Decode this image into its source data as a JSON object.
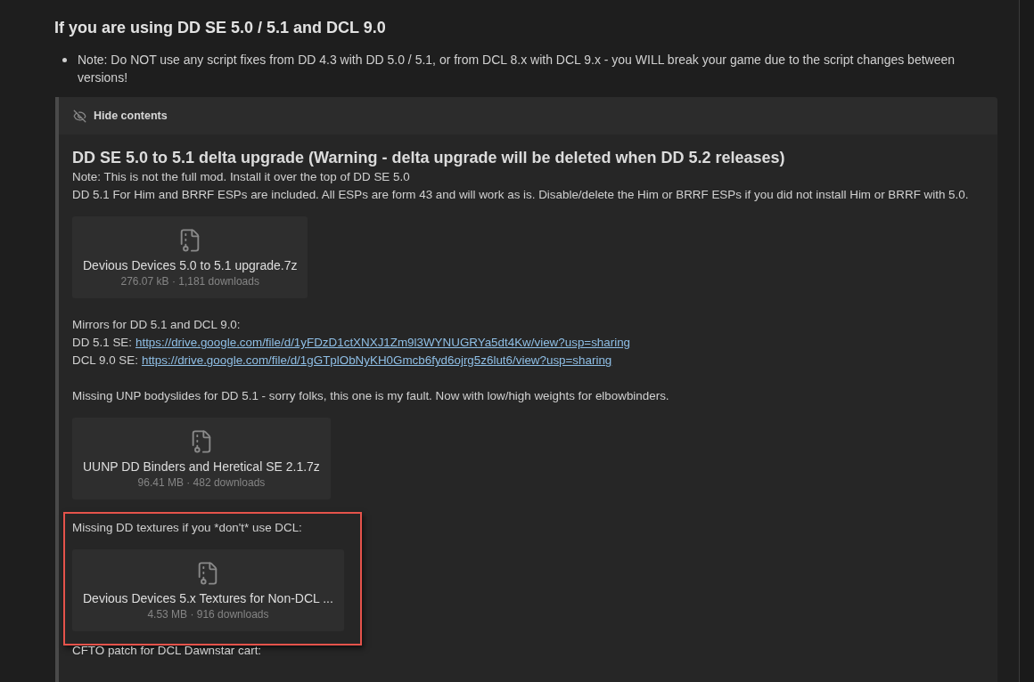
{
  "heading": "If you are using DD SE 5.0 / 5.1 and DCL 9.0",
  "notes": [
    "Note: Do NOT use any script fixes from DD 4.3 with DD 5.0 / 5.1, or from DCL 8.x with DCL 9.x - you WILL break your game due to the script changes between versions!"
  ],
  "spoiler": {
    "toggle_label": "Hide contents",
    "expanded": true,
    "blocks": [
      {
        "kind": "heading",
        "text": "DD SE 5.0 to 5.1 delta upgrade (Warning - delta upgrade will be deleted when DD 5.2 releases)"
      },
      {
        "kind": "paragraph",
        "lines": [
          "Note: This is not the full mod. Install it over the top of DD SE 5.0",
          "DD 5.1 For Him and BRRF ESPs are included. All ESPs are form 43 and will work as is. Disable/delete the Him or BRRF ESPs if you did not install Him or BRRF with 5.0."
        ]
      },
      {
        "kind": "attachment",
        "name": "Devious Devices 5.0 to 5.1 upgrade.7z",
        "meta": "276.07 kB · 1,181 downloads"
      },
      {
        "kind": "paragraph",
        "lines": [
          "Mirrors for DD 5.1 and DCL 9.0:"
        ]
      },
      {
        "kind": "links",
        "items": [
          {
            "label": "DD 5.1 SE:",
            "url": "https://drive.google.com/file/d/1yFDzD1ctXNXJ1Zm9l3WYNUGRYa5dt4Kw/view?usp=sharing"
          },
          {
            "label": "DCL 9.0 SE:",
            "url": "https://drive.google.com/file/d/1gGTplObNyKH0Gmcb6fyd6ojrg5z6lut6/view?usp=sharing"
          }
        ]
      },
      {
        "kind": "paragraph",
        "lines": [
          "Missing UNP bodyslides for DD 5.1 - sorry folks, this one is my fault. Now with low/high weights for elbowbinders."
        ]
      },
      {
        "kind": "attachment",
        "name": "UUNP DD Binders and Heretical SE 2.1.7z",
        "meta": "96.41 MB · 482 downloads"
      },
      {
        "kind": "highlight_group",
        "blocks": [
          {
            "kind": "paragraph",
            "lines": [
              "Missing DD textures if you *don't* use DCL:"
            ]
          },
          {
            "kind": "attachment",
            "name": "Devious Devices 5.x Textures for Non-DCL ...",
            "meta": "4.53 MB · 916 downloads"
          }
        ]
      },
      {
        "kind": "paragraph",
        "lines": [
          "CFTO patch for DCL Dawnstar cart:"
        ]
      }
    ]
  }
}
